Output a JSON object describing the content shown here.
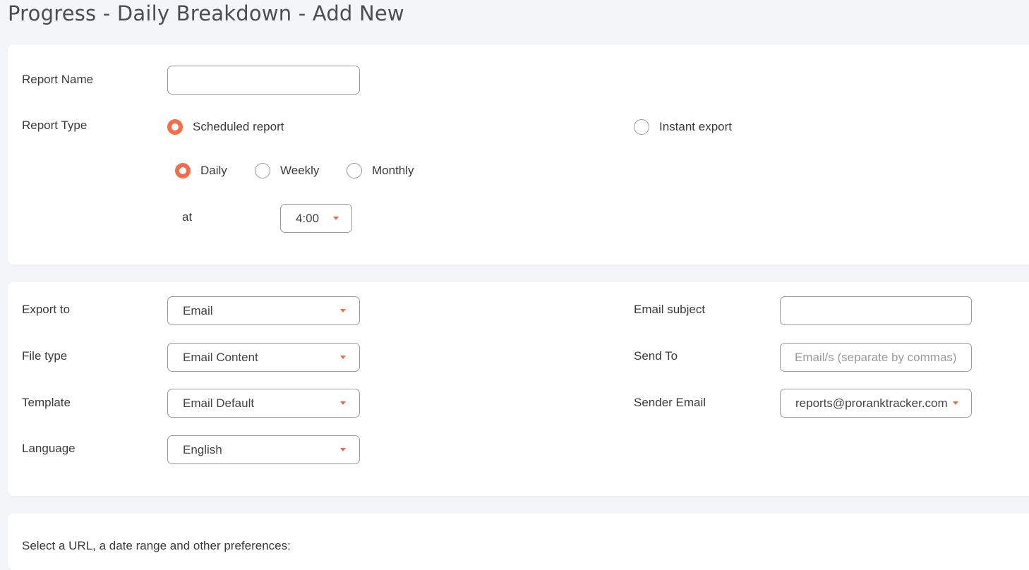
{
  "page": {
    "title": "Progress - Daily Breakdown - Add New"
  },
  "report_section": {
    "report_name": {
      "label": "Report Name",
      "value": ""
    },
    "report_type": {
      "label": "Report Type",
      "options": [
        {
          "label": "Scheduled report",
          "selected": true
        },
        {
          "label": "Instant export",
          "selected": false
        }
      ]
    },
    "frequency": {
      "options": [
        {
          "label": "Daily",
          "selected": true
        },
        {
          "label": "Weekly",
          "selected": false
        },
        {
          "label": "Monthly",
          "selected": false
        }
      ]
    },
    "time": {
      "label": "at",
      "value": "4:00"
    }
  },
  "export_section": {
    "export_to": {
      "label": "Export to",
      "value": "Email"
    },
    "file_type": {
      "label": "File type",
      "value": "Email Content"
    },
    "template": {
      "label": "Template",
      "value": "Email Default"
    },
    "language": {
      "label": "Language",
      "value": "English"
    },
    "email_subject": {
      "label": "Email subject",
      "value": ""
    },
    "send_to": {
      "label": "Send To",
      "placeholder": "Email/s (separate by commas)"
    },
    "sender_email": {
      "label": "Sender Email",
      "value": "reports@proranktracker.com"
    }
  },
  "preferences_section": {
    "heading": "Select a URL, a date range and other preferences:"
  },
  "colors": {
    "accent": "#f56b4c",
    "background": "#f3f5f9",
    "card": "#ffffff"
  },
  "icons": {
    "dropdown": "caret-down-icon"
  }
}
